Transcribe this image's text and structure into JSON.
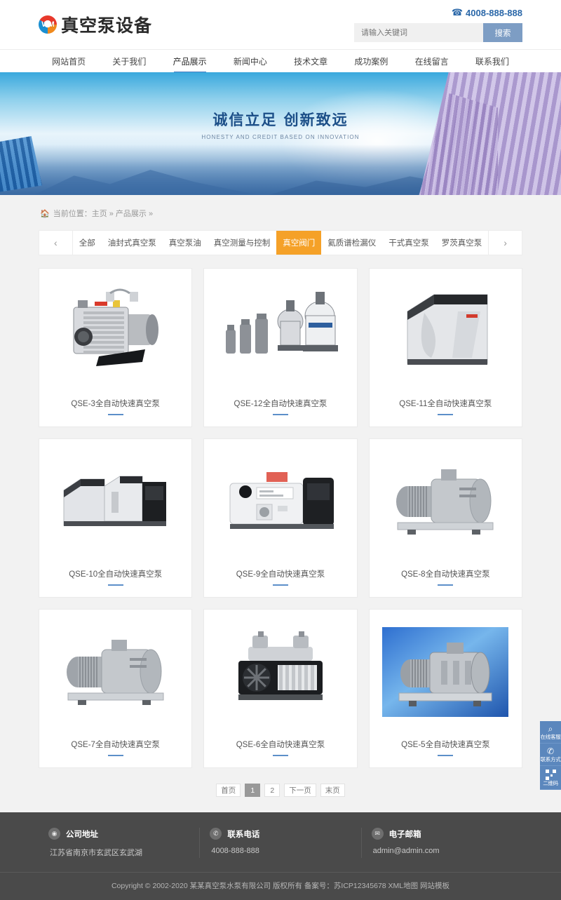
{
  "header": {
    "logo_text": "真空泵设备",
    "logo_mark": "WM",
    "phone": "4008-888-888",
    "phone_icon": "phone-icon",
    "search_placeholder": "请输入关键词",
    "search_button": "搜索"
  },
  "nav": {
    "items": [
      {
        "label": "网站首页",
        "active": false
      },
      {
        "label": "关于我们",
        "active": false
      },
      {
        "label": "产品展示",
        "active": true
      },
      {
        "label": "新闻中心",
        "active": false
      },
      {
        "label": "技术文章",
        "active": false
      },
      {
        "label": "成功案例",
        "active": false
      },
      {
        "label": "在线留言",
        "active": false
      },
      {
        "label": "联系我们",
        "active": false
      }
    ]
  },
  "banner": {
    "title": "诚信立足  创新致远",
    "subtitle": "HONESTY AND CREDIT BASED ON INNOVATION"
  },
  "breadcrumb": {
    "prefix": "当前位置：",
    "items": [
      "主页",
      "产品展示"
    ],
    "separator": "»",
    "full": "当前位置：主页 » 产品展示 »"
  },
  "categories": {
    "prev_icon": "chevron-left-icon",
    "next_icon": "chevron-right-icon",
    "items": [
      {
        "label": "全部",
        "active": false
      },
      {
        "label": "油封式真空泵",
        "active": false
      },
      {
        "label": "真空泵油",
        "active": false
      },
      {
        "label": "真空测量与控制",
        "active": false
      },
      {
        "label": "真空阀门",
        "active": true
      },
      {
        "label": "氦质谱检漏仪",
        "active": false
      },
      {
        "label": "干式真空泵",
        "active": false
      },
      {
        "label": "罗茨真空泵",
        "active": false
      }
    ],
    "active_color": "#f5a128"
  },
  "products": [
    {
      "title": "QSE-3全自动快速真空泵",
      "style": "rotary-vane"
    },
    {
      "title": "QSE-12全自动快速真空泵",
      "style": "filter-group"
    },
    {
      "title": "QSE-11全自动快速真空泵",
      "style": "cabinet"
    },
    {
      "title": "QSE-10全自动快速真空泵",
      "style": "cabinet-group"
    },
    {
      "title": "QSE-9全自动快速真空泵",
      "style": "screw-pump"
    },
    {
      "title": "QSE-8全自动快速真空泵",
      "style": "roots-motor"
    },
    {
      "title": "QSE-7全自动快速真空泵",
      "style": "roots-motor"
    },
    {
      "title": "QSE-6全自动快速真空泵",
      "style": "piston-pump"
    },
    {
      "title": "QSE-5全自动快速真空泵",
      "style": "roots-blue"
    }
  ],
  "pagination": {
    "first": "首页",
    "pages": [
      "1",
      "2"
    ],
    "active_page": "1",
    "next": "下一页",
    "last": "末页"
  },
  "footer": {
    "columns": [
      {
        "icon": "location-pin-icon",
        "title": "公司地址",
        "value": "江苏省南京市玄武区玄武湖"
      },
      {
        "icon": "phone-icon",
        "title": "联系电话",
        "value": "4008-888-888"
      },
      {
        "icon": "mail-icon",
        "title": "电子邮箱",
        "value": "admin@admin.com"
      }
    ],
    "copyright": "Copyright © 2002-2020 某某真空泵水泵有限公司 版权所有 备案号：苏ICP12345678 XML地图 网站模板"
  },
  "float_bar": {
    "items": [
      {
        "icon": "bell-icon",
        "label": "在线客服"
      },
      {
        "icon": "phone-icon",
        "label": "联系方式"
      },
      {
        "icon": "qrcode-icon",
        "label": "二维码"
      }
    ]
  }
}
